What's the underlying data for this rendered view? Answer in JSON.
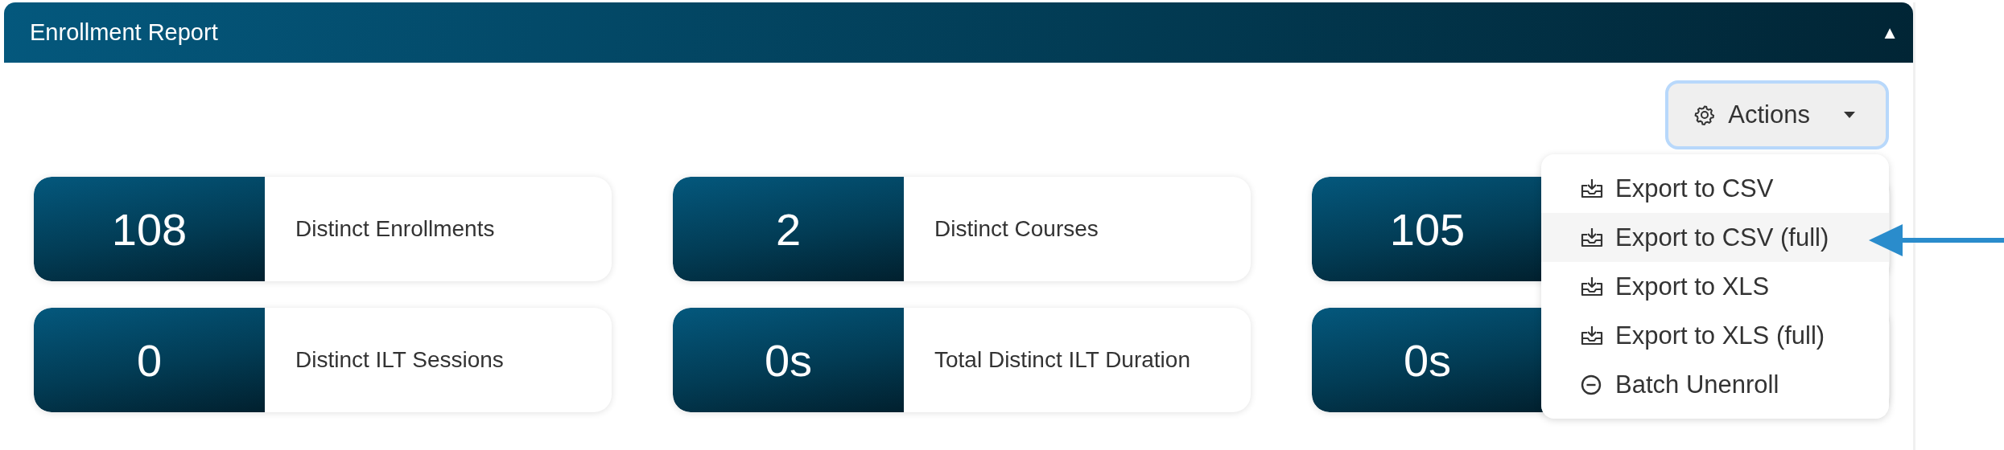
{
  "panel": {
    "title": "Enrollment Report",
    "collapse_icon": "▲",
    "expanded": true
  },
  "actions": {
    "label": "Actions",
    "open": true,
    "menu": [
      {
        "kind": "download",
        "label": "Export to CSV",
        "highlighted": false
      },
      {
        "kind": "download",
        "label": "Export to CSV (full)",
        "highlighted": true
      },
      {
        "kind": "download",
        "label": "Export to XLS",
        "highlighted": false
      },
      {
        "kind": "download",
        "label": "Export to XLS (full)",
        "highlighted": false
      },
      {
        "kind": "remove",
        "label": "Batch Unenroll",
        "highlighted": false
      }
    ]
  },
  "stats": [
    {
      "count": "108",
      "caption": "Distinct Enrollments"
    },
    {
      "count": "2",
      "caption": "Distinct Courses"
    },
    {
      "count": "105"
    },
    {
      "count": "0",
      "caption": "Distinct ILT Sessions"
    },
    {
      "count": "0s",
      "caption": "Total Distinct ILT Duration"
    },
    {
      "count": "0s"
    }
  ]
}
